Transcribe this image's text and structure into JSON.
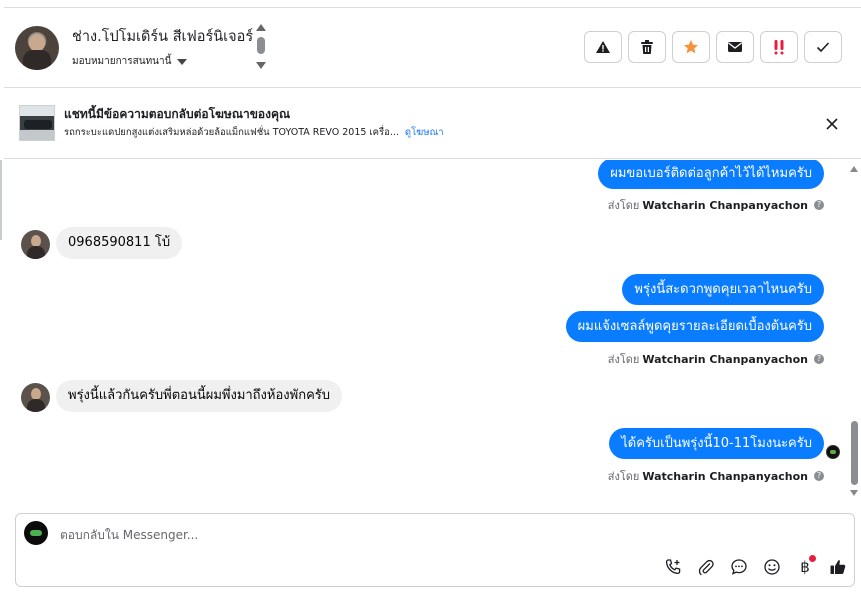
{
  "header": {
    "contact_name": "ช่าง.โปโมเดิร์น สีเฟอร์นิเจอร์",
    "assign_label": "มอบหมายการสนทนานี้",
    "actions": [
      {
        "name": "report-spam-button",
        "icon": "warning-icon"
      },
      {
        "name": "delete-button",
        "icon": "trash-icon"
      },
      {
        "name": "star-button",
        "icon": "star-icon"
      },
      {
        "name": "mark-unread-button",
        "icon": "envelope-icon"
      },
      {
        "name": "follow-up-button",
        "icon": "exclamation-icon"
      },
      {
        "name": "mark-done-button",
        "icon": "check-icon"
      }
    ],
    "colors": {
      "star": "#f5923e",
      "follow_up": "#e41e3f"
    }
  },
  "ad_banner": {
    "title": "แชทนี้มีข้อความตอบกลับต่อโฆษณาของคุณ",
    "description": "รถกระบะแดปยกสูงแต่งเสริมหล่อด้วยล้อแม็กแฟชั่น TOYOTA REVO 2015 เครื่อ...",
    "link_label": "ดูโฆษณา"
  },
  "messages": [
    {
      "direction": "out",
      "text": "ผมขอเบอร์ติดต่อลูกค้าไว้ได้ไหมครับ",
      "sent_by_prefix": "ส่งโดย",
      "sent_by": "Watcharin Chanpanyachon"
    },
    {
      "direction": "in",
      "text": "0968590811 โบ้"
    },
    {
      "direction": "out",
      "text": "พรุ่งนี้สะดวกพูดคุยเวลาไหนครับ"
    },
    {
      "direction": "out",
      "text": "ผมแจ้งเซลล์พูดคุยรายละเอียดเบื้องต้นครับ",
      "sent_by_prefix": "ส่งโดย",
      "sent_by": "Watcharin Chanpanyachon"
    },
    {
      "direction": "in",
      "text": "พรุ่งนี้แล้วกันครับพี่ตอนนี้ผมพึ่งมาถึงห้องพักครับ"
    },
    {
      "direction": "out",
      "text": "ได้ครับเป็นพรุ่งนี้10-11โมงนะครับ",
      "sent_by_prefix": "ส่งโดย",
      "sent_by": "Watcharin Chanpanyachon"
    }
  ],
  "composer": {
    "placeholder": "ตอบกลับใน Messenger...",
    "tools": [
      "add-call-icon",
      "paperclip-icon",
      "chat-bubble-icon",
      "emoji-icon",
      "baht-icon",
      "thumbs-up-icon"
    ],
    "baht_symbol": "฿"
  },
  "theme": {
    "bubble_out": "#0a7cff",
    "bubble_in": "#f0f0f0",
    "link": "#1877f2"
  }
}
